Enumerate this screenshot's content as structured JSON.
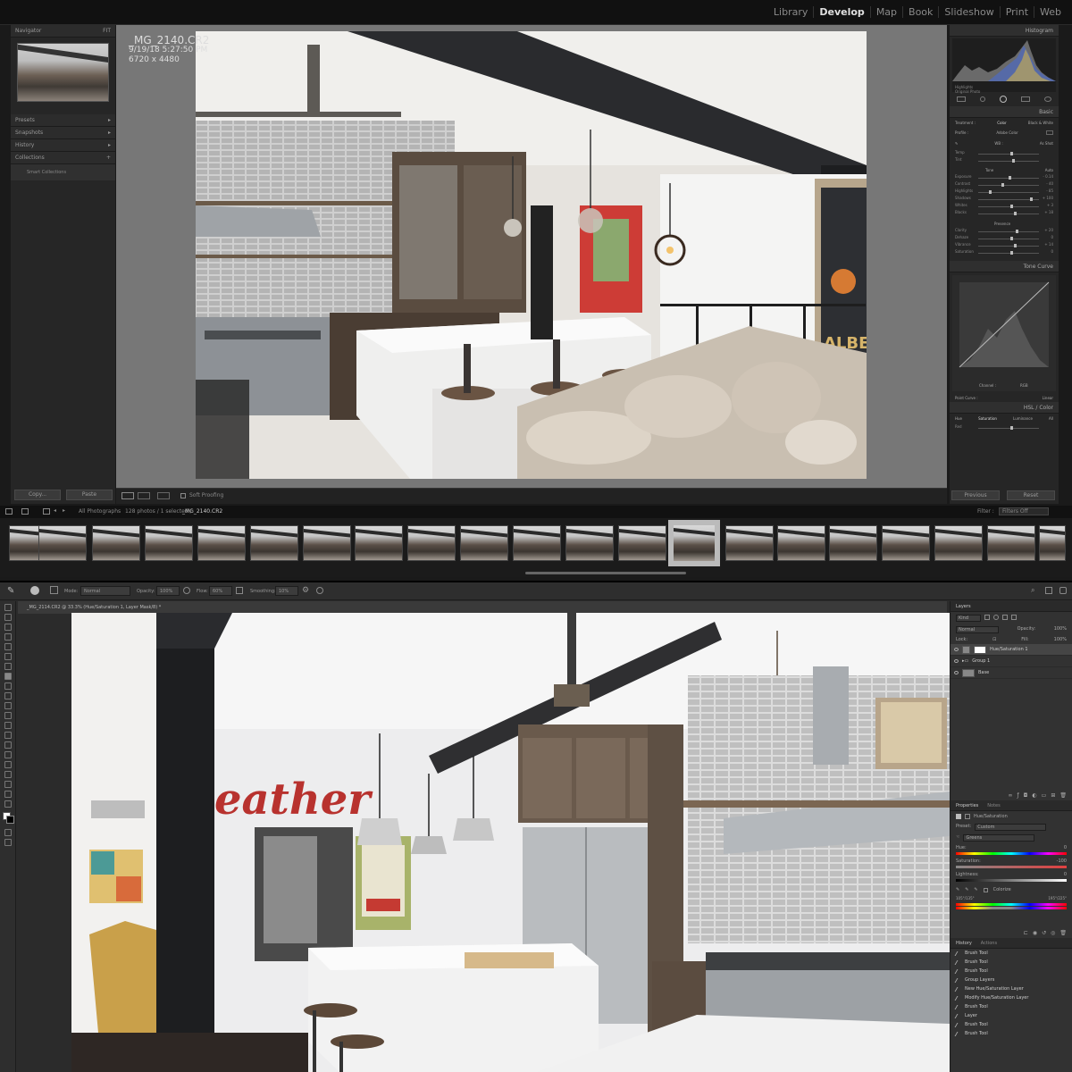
{
  "lightroom": {
    "modules": [
      "Library",
      "Develop",
      "Map",
      "Book",
      "Slideshow",
      "Print",
      "Web"
    ],
    "active_module": "Develop",
    "left_panels": {
      "navigator": "Navigator",
      "navigator_zoom": "FIT",
      "presets": "Presets",
      "snapshots": "Snapshots",
      "history": "History",
      "collections": "Collections",
      "collection_item": "Smart Collections"
    },
    "copy_label": "Copy...",
    "paste_label": "Paste",
    "image_info": {
      "filename": "_MG_2140.CR2",
      "datetime": "9/19/18 5:27:50 PM",
      "dimensions": "6720 x 4480"
    },
    "toolbar": {
      "soft_proofing": "Soft Proofing"
    },
    "right_panels": {
      "histogram": "Histogram",
      "highlights": "Highlights",
      "original_photo": "Original Photo",
      "basic": "Basic",
      "treatment": "Treatment :",
      "color": "Color",
      "bw": "Black & White",
      "profile": "Profile :",
      "profile_value": "Adobe Color",
      "wb": "WB :",
      "wb_value": "As Shot",
      "temp": "Temp",
      "tint": "Tint",
      "tone": "Tone",
      "auto": "Auto",
      "exposure": "Exposure",
      "exposure_value": "- 0.14",
      "contrast": "Contrast",
      "contrast_value": "- 40",
      "highlights_s": "Highlights",
      "highlights_value": "- 85",
      "shadows": "Shadows",
      "shadows_value": "+ 100",
      "whites": "Whites",
      "whites_value": "+ 3",
      "blacks": "Blacks",
      "blacks_value": "+ 18",
      "presence": "Presence",
      "clarity": "Clarity",
      "clarity_value": "+ 20",
      "dehaze": "Dehaze",
      "dehaze_value": "0",
      "vibrance": "Vibrance",
      "vibrance_value": "+ 14",
      "saturation": "Saturation",
      "saturation_value": "0",
      "tone_curve": "Tone Curve",
      "channel": "Channel :",
      "channel_value": "RGB",
      "point_curve": "Point Curve :",
      "point_curve_value": "Linear",
      "hsl_color": "HSL / Color",
      "hue": "Hue",
      "saturation_tab": "Saturation",
      "luminance": "Luminance",
      "all": "All",
      "sat_red": "Red"
    },
    "previous_label": "Previous",
    "reset_label": "Reset",
    "filmstrip": {
      "source": "All Photographs",
      "status": "128 photos / 1 selected /",
      "current": "_MG_2140.CR2",
      "filter_label": "Filter :",
      "filter_value": "Filters Off"
    }
  },
  "photoshop": {
    "options": {
      "mode_label": "Mode:",
      "mode_value": "Normal",
      "opacity_label": "Opacity:",
      "opacity_value": "100%",
      "flow_label": "Flow:",
      "flow_value": "60%",
      "smoothing_label": "Smoothing:",
      "smoothing_value": "10%"
    },
    "doc_tab": "_MG_2114.CR2 @ 33.3% (Hue/Saturation 1, Layer Mask/8) *",
    "layers_panel": {
      "title": "Layers",
      "kind": "Kind",
      "blend": "Normal",
      "opacity_label": "Opacity:",
      "opacity_value": "100%",
      "lock_label": "Lock:",
      "fill_label": "Fill:",
      "fill_value": "100%",
      "layers": [
        "Hue/Saturation 1",
        "Group 1",
        "Base"
      ]
    },
    "properties_panel": {
      "tab1": "Properties",
      "tab2": "Notes",
      "type": "Hue/Saturation",
      "preset_label": "Preset:",
      "preset_value": "Custom",
      "channel_value": "Greens",
      "hue_label": "Hue:",
      "hue_value": "0",
      "saturation_label": "Saturation:",
      "saturation_value": "-100",
      "lightness_label": "Lightness:",
      "lightness_value": "0",
      "colorize": "Colorize",
      "range_left": "105°/135°",
      "range_right": "195°/225°"
    },
    "history_panel": {
      "tab1": "History",
      "tab2": "Actions",
      "items": [
        "Brush Tool",
        "Brush Tool",
        "Brush Tool",
        "Group Layers",
        "New Hue/Saturation Layer",
        "Modify Hue/Saturation Layer",
        "Brush Tool",
        "Layer",
        "Brush Tool",
        "Brush Tool"
      ]
    },
    "photo_text": "eather"
  },
  "photo_text": {
    "lr_sign": "ALBE"
  }
}
